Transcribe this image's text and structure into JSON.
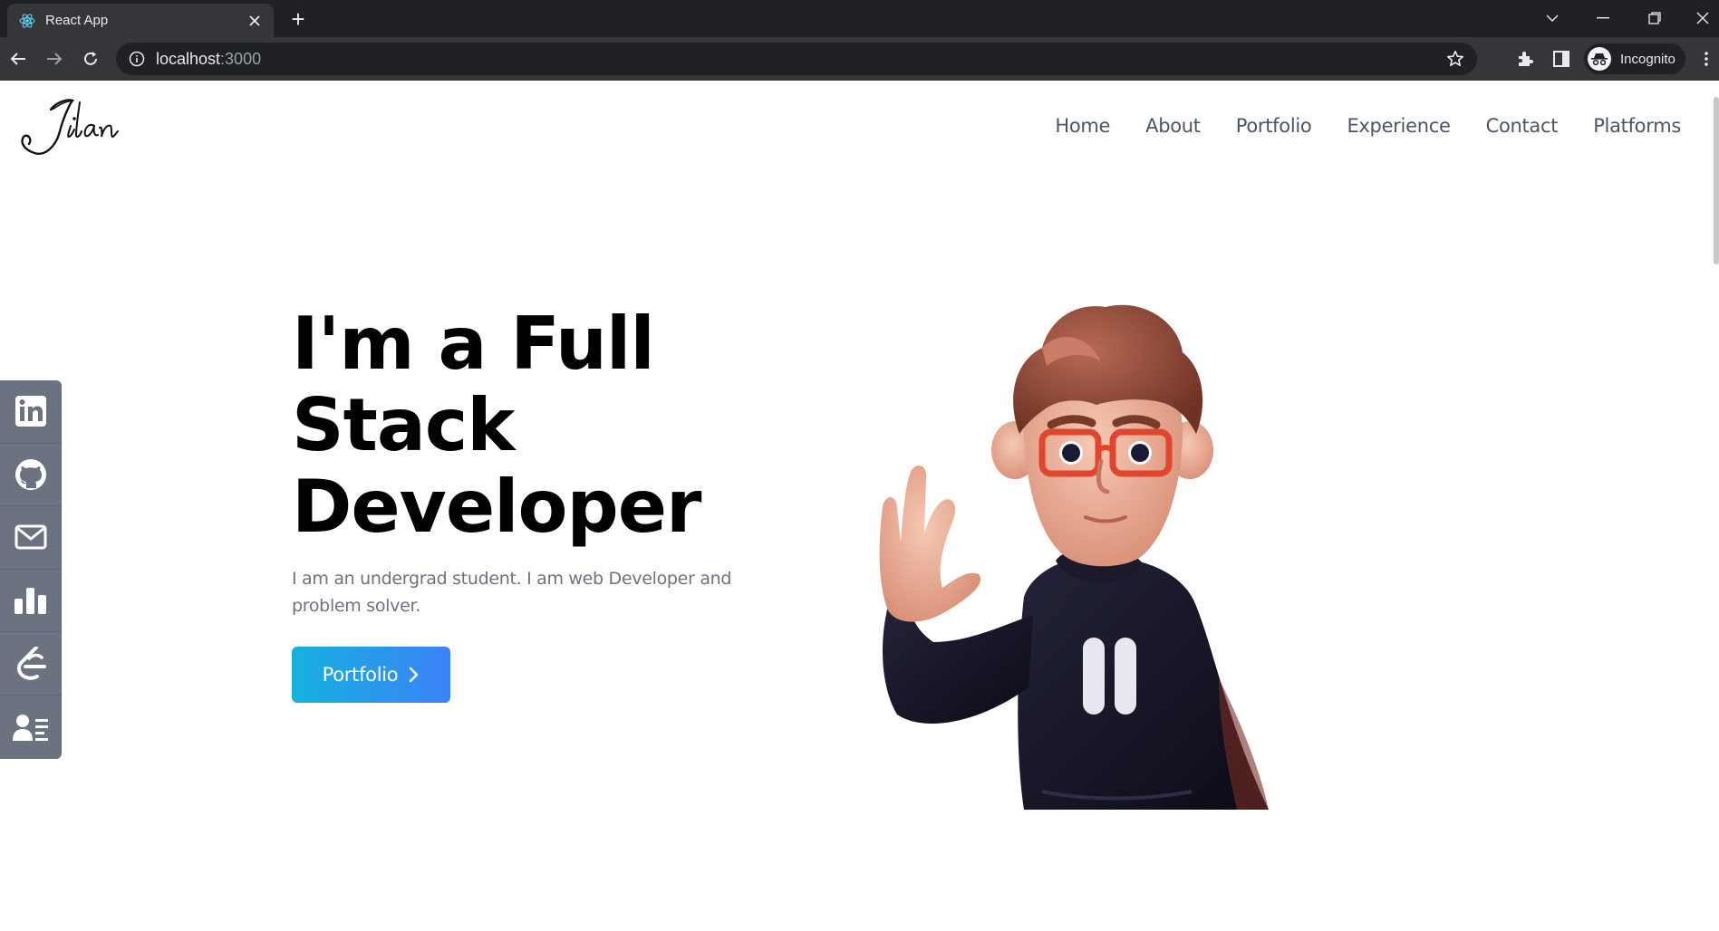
{
  "browser": {
    "tab_title": "React App",
    "new_tab": "+",
    "url_host": "localhost",
    "url_port": ":3000",
    "profile_label": "Incognito"
  },
  "site": {
    "logo_text": "Jilan",
    "nav": [
      "Home",
      "About",
      "Portfolio",
      "Experience",
      "Contact",
      "Platforms"
    ],
    "hero": {
      "title_line1": "I'm a Full",
      "title_line2": "Stack",
      "title_line3": "Developer",
      "subtitle": "I am an undergrad student. I am web Developer and problem solver.",
      "button_label": "Portfolio"
    },
    "social_links": [
      "linkedin-icon",
      "github-icon",
      "mail-icon",
      "stats-icon",
      "codechef-icon",
      "resume-icon"
    ]
  },
  "colors": {
    "chrome_dark": "#202124",
    "chrome_tab": "#35363a",
    "sidebar": "#6b7280",
    "button_from": "#15b2de",
    "button_to": "#3b82f6"
  }
}
